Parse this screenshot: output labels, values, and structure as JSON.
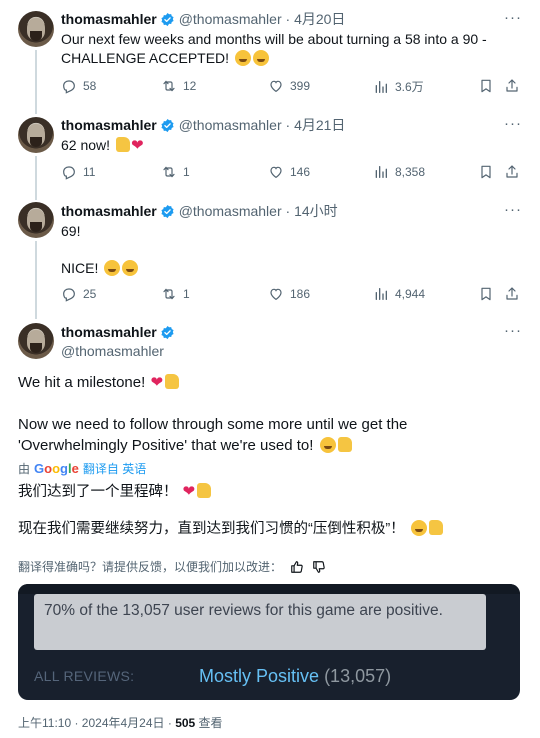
{
  "tweets": [
    {
      "username": "thomasmahler",
      "handle": "@thomasmahler",
      "time": "4月20日",
      "text_line1": "Our next few weeks and months will be about turning a 58 into a 90 -",
      "text_line2": "CHALLENGE ACCEPTED!",
      "replies": "58",
      "retweets": "12",
      "likes": "399",
      "views": "3.6万"
    },
    {
      "username": "thomasmahler",
      "handle": "@thomasmahler",
      "time": "4月21日",
      "text_line1": "62 now!",
      "replies": "11",
      "retweets": "1",
      "likes": "146",
      "views": "8,358"
    },
    {
      "username": "thomasmahler",
      "handle": "@thomasmahler",
      "time": "14小时",
      "text_line1": "69!",
      "text_line2": "NICE!",
      "replies": "25",
      "retweets": "1",
      "likes": "186",
      "views": "4,944"
    }
  ],
  "main": {
    "username": "thomasmahler",
    "handle": "@thomasmahler",
    "text_line1": "We hit a milestone!",
    "text_line2": "Now we need to follow through some more until we get the",
    "text_line3": "'Overwhelmingly Positive' that we're used to!",
    "translate_by": "由",
    "translate_google": "Google",
    "translate_from": "翻译自 英语",
    "zh_line1": "我们达到了一个里程碑！",
    "zh_line2": "现在我们需要继续努力，直到达到我们习惯的“压倒性积极”！",
    "feedback": "翻译得准确吗？请提供反馈，以便我们加以改进：",
    "steam": {
      "tooltip": "70% of the 13,057 user reviews for this game are positive.",
      "label": "ALL REVIEWS:",
      "rating": "Mostly Positive",
      "count": "(13,057)"
    },
    "meta_time": "上午11:10 · 2024年4月24日 · ",
    "meta_views": "505",
    "meta_views_label": " 查看"
  }
}
